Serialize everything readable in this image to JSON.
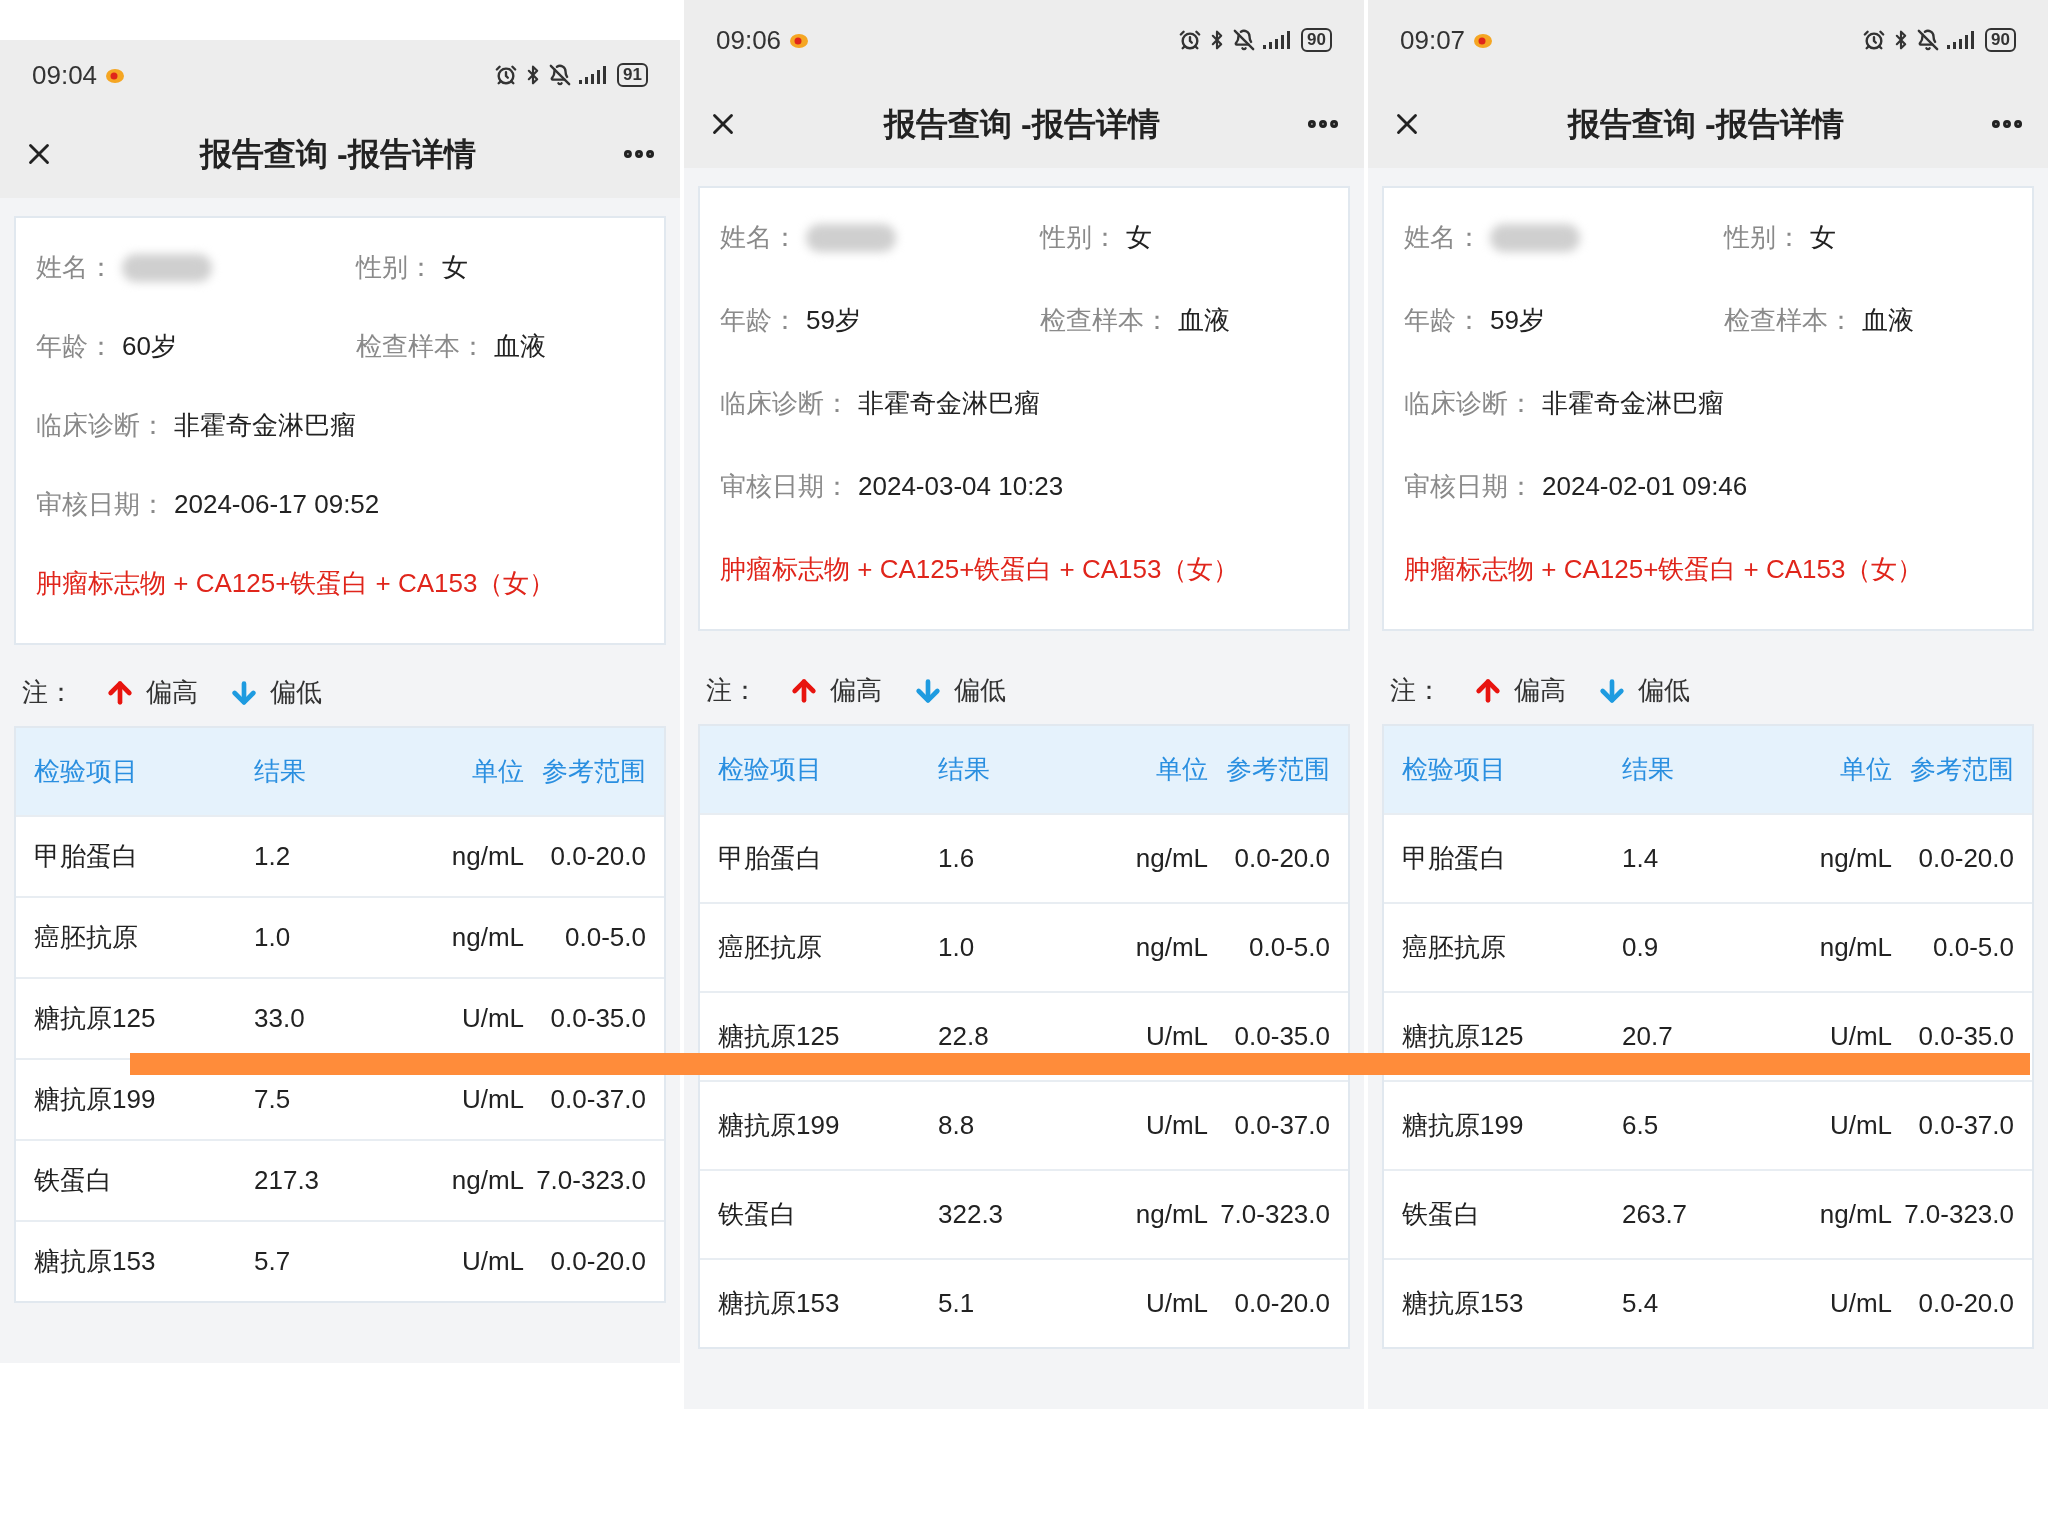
{
  "screens": [
    {
      "status_bar": {
        "time": "09:04",
        "battery": "91"
      },
      "title": "报告查询 -报告详情",
      "fields": [
        {
          "label": "姓名：",
          "kind": "blurred"
        },
        {
          "label": "性别：",
          "value": "女",
          "kind": "text"
        },
        {
          "label": "年龄：",
          "value": "60岁",
          "kind": "text"
        },
        {
          "label": "检查样本：",
          "value": "血液",
          "kind": "text"
        },
        {
          "label": "临床诊断：",
          "value": "非霍奇金淋巴瘤",
          "kind": "line"
        },
        {
          "label": "审核日期：",
          "value": "2024-06-17 09:52",
          "kind": "line"
        }
      ],
      "test_name": "肿瘤标志物 + CA125+铁蛋白 + CA153（女）",
      "legend": {
        "note": "注：",
        "high": "偏高",
        "low": "偏低"
      },
      "columns": [
        "检验项目",
        "结果",
        "单位",
        "参考范围"
      ],
      "rows": [
        {
          "item": "甲胎蛋白",
          "result": "1.2",
          "unit": "ng/mL",
          "range": "0.0-20.0"
        },
        {
          "item": "癌胚抗原",
          "result": "1.0",
          "unit": "ng/mL",
          "range": "0.0-5.0"
        },
        {
          "item": "糖抗原125",
          "result": "33.0",
          "unit": "U/mL",
          "range": "0.0-35.0"
        },
        {
          "item": "糖抗原199",
          "result": "7.5",
          "unit": "U/mL",
          "range": "0.0-37.0"
        },
        {
          "item": "铁蛋白",
          "result": "217.3",
          "unit": "ng/mL",
          "range": "7.0-323.0"
        },
        {
          "item": "糖抗原153",
          "result": "5.7",
          "unit": "U/mL",
          "range": "0.0-20.0"
        }
      ]
    },
    {
      "status_bar": {
        "time": "09:06",
        "battery": "90"
      },
      "title": "报告查询 -报告详情",
      "fields": [
        {
          "label": "姓名：",
          "kind": "blurred"
        },
        {
          "label": "性别：",
          "value": "女",
          "kind": "text"
        },
        {
          "label": "年龄：",
          "value": "59岁",
          "kind": "text"
        },
        {
          "label": "检查样本：",
          "value": "血液",
          "kind": "text"
        },
        {
          "label": "临床诊断：",
          "value": "非霍奇金淋巴瘤",
          "kind": "line"
        },
        {
          "label": "审核日期：",
          "value": "2024-03-04 10:23",
          "kind": "line"
        }
      ],
      "test_name": "肿瘤标志物 + CA125+铁蛋白 + CA153（女）",
      "legend": {
        "note": "注：",
        "high": "偏高",
        "low": "偏低"
      },
      "columns": [
        "检验项目",
        "结果",
        "单位",
        "参考范围"
      ],
      "rows": [
        {
          "item": "甲胎蛋白",
          "result": "1.6",
          "unit": "ng/mL",
          "range": "0.0-20.0"
        },
        {
          "item": "癌胚抗原",
          "result": "1.0",
          "unit": "ng/mL",
          "range": "0.0-5.0"
        },
        {
          "item": "糖抗原125",
          "result": "22.8",
          "unit": "U/mL",
          "range": "0.0-35.0"
        },
        {
          "item": "糖抗原199",
          "result": "8.8",
          "unit": "U/mL",
          "range": "0.0-37.0"
        },
        {
          "item": "铁蛋白",
          "result": "322.3",
          "unit": "ng/mL",
          "range": "7.0-323.0"
        },
        {
          "item": "糖抗原153",
          "result": "5.1",
          "unit": "U/mL",
          "range": "0.0-20.0"
        }
      ]
    },
    {
      "status_bar": {
        "time": "09:07",
        "battery": "90"
      },
      "title": "报告查询 -报告详情",
      "fields": [
        {
          "label": "姓名：",
          "kind": "blurred"
        },
        {
          "label": "性别：",
          "value": "女",
          "kind": "text"
        },
        {
          "label": "年龄：",
          "value": "59岁",
          "kind": "text"
        },
        {
          "label": "检查样本：",
          "value": "血液",
          "kind": "text"
        },
        {
          "label": "临床诊断：",
          "value": "非霍奇金淋巴瘤",
          "kind": "line"
        },
        {
          "label": "审核日期：",
          "value": "2024-02-01 09:46",
          "kind": "line"
        }
      ],
      "test_name": "肿瘤标志物 + CA125+铁蛋白 + CA153（女）",
      "legend": {
        "note": "注：",
        "high": "偏高",
        "low": "偏低"
      },
      "columns": [
        "检验项目",
        "结果",
        "单位",
        "参考范围"
      ],
      "rows": [
        {
          "item": "甲胎蛋白",
          "result": "1.4",
          "unit": "ng/mL",
          "range": "0.0-20.0"
        },
        {
          "item": "癌胚抗原",
          "result": "0.9",
          "unit": "ng/mL",
          "range": "0.0-5.0"
        },
        {
          "item": "糖抗原125",
          "result": "20.7",
          "unit": "U/mL",
          "range": "0.0-35.0"
        },
        {
          "item": "糖抗原199",
          "result": "6.5",
          "unit": "U/mL",
          "range": "0.0-37.0"
        },
        {
          "item": "铁蛋白",
          "result": "263.7",
          "unit": "ng/mL",
          "range": "7.0-323.0"
        },
        {
          "item": "糖抗原153",
          "result": "5.4",
          "unit": "U/mL",
          "range": "0.0-20.0"
        }
      ]
    }
  ]
}
